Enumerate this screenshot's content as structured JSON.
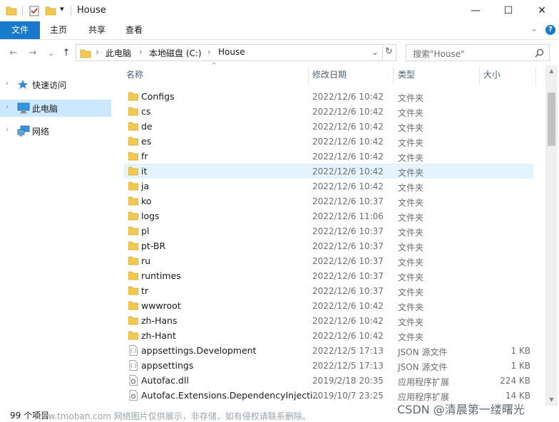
{
  "window": {
    "title": "House",
    "minimize_glyph": "—",
    "maximize_glyph": "☐",
    "close_glyph": "✕",
    "dropdown_glyph": "▾"
  },
  "ribbon": {
    "tabs": [
      "文件",
      "主页",
      "共享",
      "查看"
    ],
    "collapse_glyph": "⌄",
    "help_glyph": "?"
  },
  "address": {
    "segments": [
      "此电脑",
      "本地磁盘 (C:)",
      "House"
    ],
    "separator_glyph": "›",
    "dropdown_glyph": "⌄",
    "refresh_glyph": "↻"
  },
  "search": {
    "placeholder": "搜索\"House\"",
    "icon": "search-icon"
  },
  "nav": {
    "back_glyph": "←",
    "forward_glyph": "→",
    "recent_glyph": "⌄",
    "up_glyph": "↑"
  },
  "sidebar": {
    "items": [
      {
        "label": "快速访问",
        "icon": "star-icon",
        "selected": false
      },
      {
        "label": "此电脑",
        "icon": "computer-icon",
        "selected": true
      },
      {
        "label": "网络",
        "icon": "network-icon",
        "selected": false
      }
    ],
    "chevron_glyph": "›"
  },
  "columns": {
    "name": "名称",
    "date": "修改日期",
    "type": "类型",
    "size": "大小",
    "sort_glyph": "^"
  },
  "files": [
    {
      "name": "Configs",
      "date": "2022/12/6 10:42",
      "type": "文件夹",
      "size": "",
      "kind": "folder"
    },
    {
      "name": "cs",
      "date": "2022/12/6 10:42",
      "type": "文件夹",
      "size": "",
      "kind": "folder"
    },
    {
      "name": "de",
      "date": "2022/12/6 10:42",
      "type": "文件夹",
      "size": "",
      "kind": "folder"
    },
    {
      "name": "es",
      "date": "2022/12/6 10:42",
      "type": "文件夹",
      "size": "",
      "kind": "folder"
    },
    {
      "name": "fr",
      "date": "2022/12/6 10:42",
      "type": "文件夹",
      "size": "",
      "kind": "folder"
    },
    {
      "name": "it",
      "date": "2022/12/6 10:42",
      "type": "文件夹",
      "size": "",
      "kind": "folder",
      "hover": true
    },
    {
      "name": "ja",
      "date": "2022/12/6 10:42",
      "type": "文件夹",
      "size": "",
      "kind": "folder"
    },
    {
      "name": "ko",
      "date": "2022/12/6 10:37",
      "type": "文件夹",
      "size": "",
      "kind": "folder"
    },
    {
      "name": "logs",
      "date": "2022/12/6 11:06",
      "type": "文件夹",
      "size": "",
      "kind": "folder"
    },
    {
      "name": "pl",
      "date": "2022/12/6 10:37",
      "type": "文件夹",
      "size": "",
      "kind": "folder"
    },
    {
      "name": "pt-BR",
      "date": "2022/12/6 10:37",
      "type": "文件夹",
      "size": "",
      "kind": "folder"
    },
    {
      "name": "ru",
      "date": "2022/12/6 10:37",
      "type": "文件夹",
      "size": "",
      "kind": "folder"
    },
    {
      "name": "runtimes",
      "date": "2022/12/6 10:37",
      "type": "文件夹",
      "size": "",
      "kind": "folder"
    },
    {
      "name": "tr",
      "date": "2022/12/6 10:37",
      "type": "文件夹",
      "size": "",
      "kind": "folder"
    },
    {
      "name": "wwwroot",
      "date": "2022/12/6 10:42",
      "type": "文件夹",
      "size": "",
      "kind": "folder"
    },
    {
      "name": "zh-Hans",
      "date": "2022/12/6 10:42",
      "type": "文件夹",
      "size": "",
      "kind": "folder"
    },
    {
      "name": "zh-Hant",
      "date": "2022/12/6 10:42",
      "type": "文件夹",
      "size": "",
      "kind": "folder"
    },
    {
      "name": "appsettings.Development",
      "date": "2022/12/5 17:13",
      "type": "JSON 源文件",
      "size": "1 KB",
      "kind": "json"
    },
    {
      "name": "appsettings",
      "date": "2022/12/5 17:13",
      "type": "JSON 源文件",
      "size": "1 KB",
      "kind": "json"
    },
    {
      "name": "Autofac.dll",
      "date": "2019/2/18 20:35",
      "type": "应用程序扩展",
      "size": "224 KB",
      "kind": "dll"
    },
    {
      "name": "Autofac.Extensions.DependencyInjecti...",
      "date": "2019/10/7 23:25",
      "type": "应用程序扩展",
      "size": "14 KB",
      "kind": "dll"
    }
  ],
  "status": {
    "count": "99 个项目",
    "watermark": "www.tmoban.com 网络图片仅供展示，非存储，如有侵权请联系删除。"
  },
  "overlay": {
    "csdn": "CSDN @清晨第一缕曙光"
  },
  "colors": {
    "accent": "#1979ca",
    "folder": "#f3c84f",
    "selected": "#cce8ff",
    "hover": "#e5f3ff"
  }
}
